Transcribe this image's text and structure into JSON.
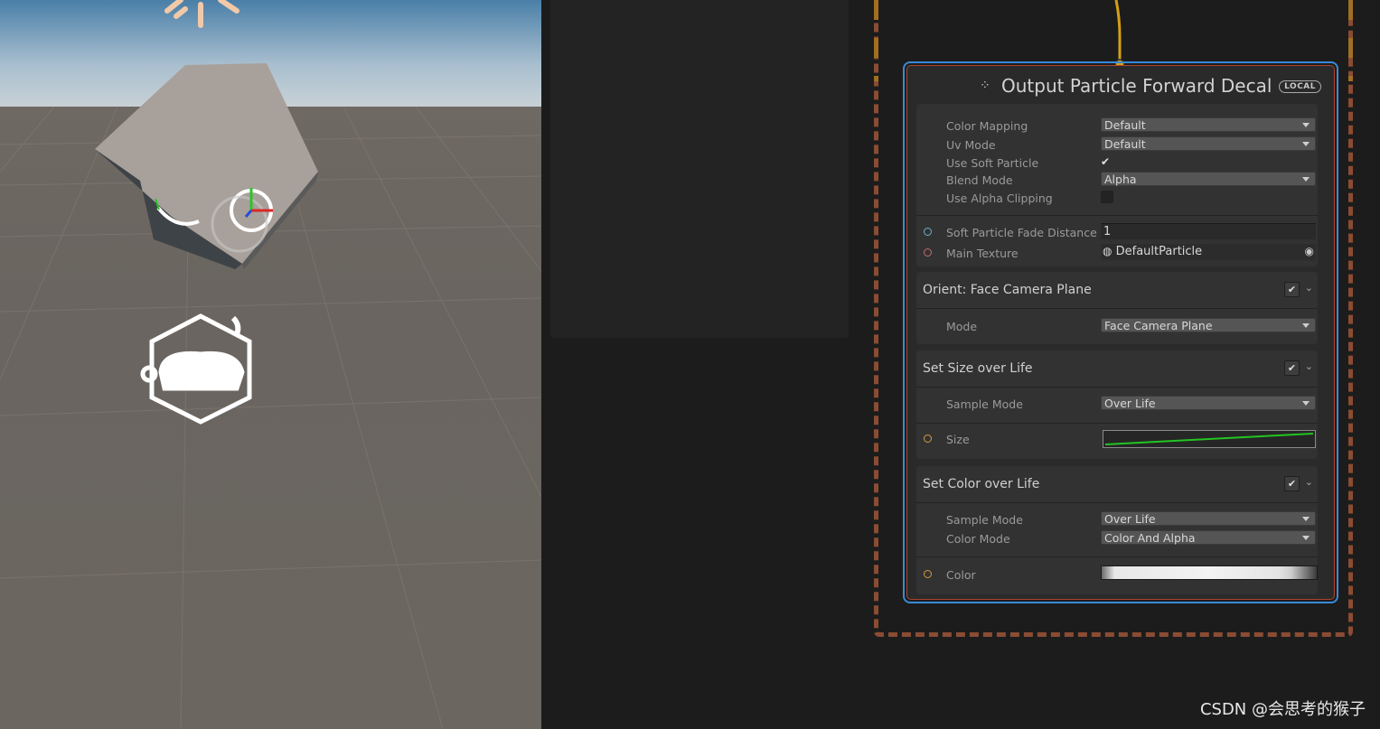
{
  "node": {
    "title": "Output Particle Forward Decal",
    "badge": "LOCAL",
    "settings": [
      {
        "label": "Color Mapping",
        "value": "Default",
        "type": "dropdown"
      },
      {
        "label": "Uv Mode",
        "value": "Default",
        "type": "dropdown"
      },
      {
        "label": "Use Soft Particle",
        "checked": true,
        "type": "checkbox"
      },
      {
        "label": "Blend Mode",
        "value": "Alpha",
        "type": "dropdown"
      },
      {
        "label": "Use Alpha Clipping",
        "checked": false,
        "type": "checkbox"
      }
    ],
    "inputs": [
      {
        "label": "Soft Particle Fade Distance",
        "value": "1"
      },
      {
        "label": "Main Texture",
        "value": "DefaultParticle"
      }
    ],
    "blocks": [
      {
        "title": "Orient: Face Camera Plane",
        "enabled": true,
        "fields": [
          {
            "label": "Mode",
            "value": "Face Camera Plane"
          }
        ]
      },
      {
        "title": "Set Size over Life",
        "enabled": true,
        "fields": [
          {
            "label": "Sample Mode",
            "value": "Over Life"
          }
        ],
        "port": {
          "label": "Size"
        }
      },
      {
        "title": "Set Color over Life",
        "enabled": true,
        "fields": [
          {
            "label": "Sample Mode",
            "value": "Over Life"
          },
          {
            "label": "Color Mode",
            "value": "Color And Alpha"
          }
        ],
        "port": {
          "label": "Color"
        }
      }
    ]
  },
  "watermark": "CSDN @会思考的猴子",
  "colors": {
    "selection": "#3a8ad8",
    "context_border": "#b0452c",
    "flow_wire": "#d4a017",
    "curve": "#22c422"
  }
}
